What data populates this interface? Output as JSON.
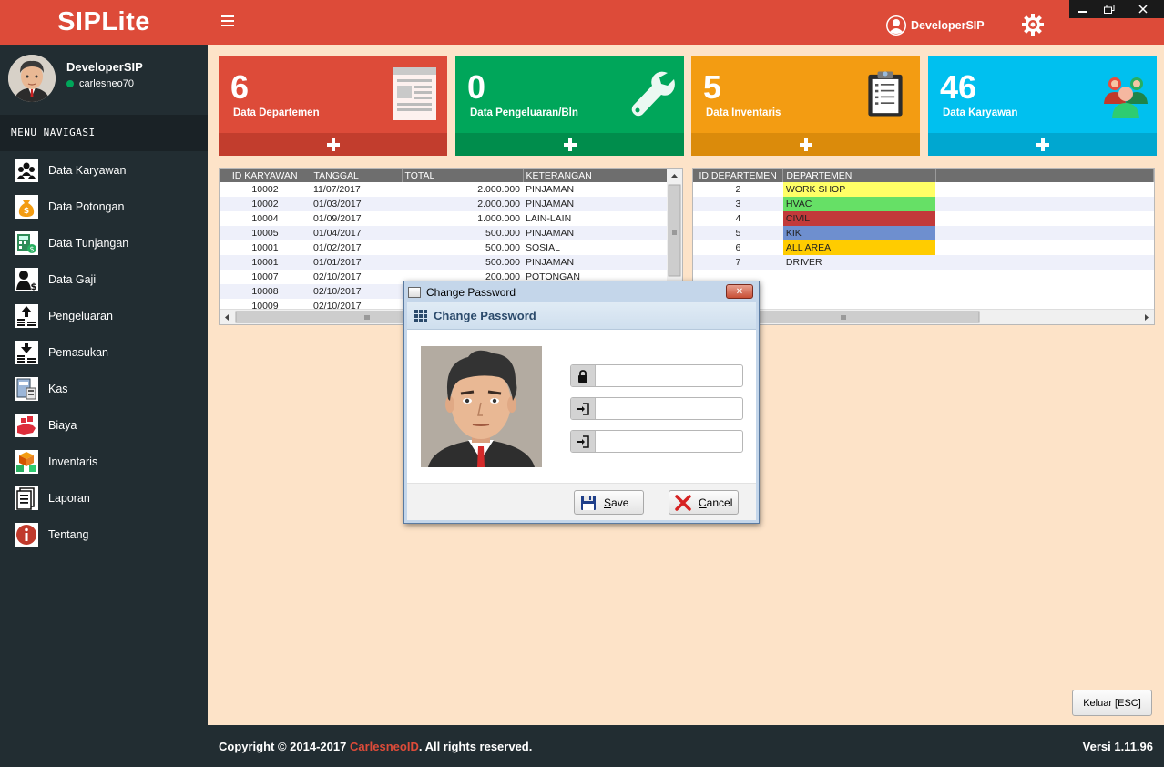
{
  "app": {
    "brand": "SIPLite"
  },
  "sidebar": {
    "user_name": "DeveloperSIP",
    "user_status": "carlesneo70",
    "menu_header": "MENU NAVIGASI",
    "items": [
      {
        "label": "Data Karyawan",
        "icon": "people-icon"
      },
      {
        "label": "Data Potongan",
        "icon": "money-bag-icon"
      },
      {
        "label": "Data Tunjangan",
        "icon": "calculator-icon"
      },
      {
        "label": "Data Gaji",
        "icon": "user-dollar-icon"
      },
      {
        "label": "Pengeluaran",
        "icon": "upload-coins-icon"
      },
      {
        "label": "Pemasukan",
        "icon": "download-coins-icon"
      },
      {
        "label": "Kas",
        "icon": "cash-register-icon"
      },
      {
        "label": "Biaya",
        "icon": "cost-hand-icon"
      },
      {
        "label": "Inventaris",
        "icon": "boxes-icon"
      },
      {
        "label": "Laporan",
        "icon": "report-icon"
      },
      {
        "label": "Tentang",
        "icon": "info-icon"
      }
    ]
  },
  "topbar": {
    "user_name": "DeveloperSIP"
  },
  "tiles": [
    {
      "value": "6",
      "label": "Data Departemen",
      "color": "#dd4b39",
      "footer_color": "#c23d2d"
    },
    {
      "value": "0",
      "label": "Data Pengeluaran/Bln",
      "color": "#00a65a",
      "footer_color": "#008d4c"
    },
    {
      "value": "5",
      "label": "Data Inventaris",
      "color": "#f39c12",
      "footer_color": "#db8b0b"
    },
    {
      "value": "46",
      "label": "Data Karyawan",
      "color": "#00c0ef",
      "footer_color": "#00a7d0"
    }
  ],
  "left_grid": {
    "headers": [
      "ID KARYAWAN",
      "TANGGAL",
      "TOTAL",
      "KETERANGAN"
    ],
    "rows": [
      [
        "10002",
        "11/07/2017",
        "2.000.000",
        "PINJAMAN"
      ],
      [
        "10002",
        "01/03/2017",
        "2.000.000",
        "PINJAMAN"
      ],
      [
        "10004",
        "01/09/2017",
        "1.000.000",
        "LAIN-LAIN"
      ],
      [
        "10005",
        "01/04/2017",
        "500.000",
        "PINJAMAN"
      ],
      [
        "10001",
        "01/02/2017",
        "500.000",
        "SOSIAL"
      ],
      [
        "10001",
        "01/01/2017",
        "500.000",
        "PINJAMAN"
      ],
      [
        "10007",
        "02/10/2017",
        "200.000",
        "POTONGAN"
      ],
      [
        "10008",
        "02/10/2017",
        "",
        ""
      ],
      [
        "10009",
        "02/10/2017",
        "",
        ""
      ]
    ]
  },
  "right_grid": {
    "headers": [
      "ID DEPARTEMEN",
      "DEPARTEMEN"
    ],
    "rows": [
      {
        "id": "2",
        "name": "WORK SHOP",
        "color": "#ffff66"
      },
      {
        "id": "3",
        "name": "HVAC",
        "color": "#66e066"
      },
      {
        "id": "4",
        "name": "CIVIL",
        "color": "#c23a3a"
      },
      {
        "id": "5",
        "name": "KIK",
        "color": "#6e8fcf"
      },
      {
        "id": "6",
        "name": "ALL AREA",
        "color": "#ffcc00"
      },
      {
        "id": "7",
        "name": "DRIVER",
        "color": ""
      }
    ]
  },
  "dialog": {
    "window_title": "Change Password",
    "header": "Change Password",
    "fields": [
      {
        "icon": "lock-icon",
        "value": ""
      },
      {
        "icon": "sign-in-icon",
        "value": ""
      },
      {
        "icon": "sign-in-icon",
        "value": ""
      }
    ],
    "save_label": "Save",
    "cancel_label": "Cancel"
  },
  "keluar_label": "Keluar [ESC]",
  "footer": {
    "copyright_prefix": "Copyright © 2014-2017 ",
    "copyright_link": "CarlesneoID",
    "copyright_suffix": ". All rights reserved.",
    "version": "Versi 1.11.96"
  }
}
